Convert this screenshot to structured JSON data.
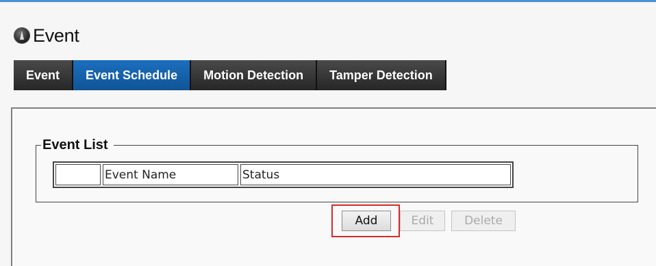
{
  "page": {
    "title": "Event"
  },
  "tabs": [
    {
      "label": "Event",
      "active": false
    },
    {
      "label": "Event Schedule",
      "active": true
    },
    {
      "label": "Motion Detection",
      "active": false
    },
    {
      "label": "Tamper Detection",
      "active": false
    }
  ],
  "event_list": {
    "legend": "Event List",
    "columns": [
      "",
      "Event Name",
      "Status"
    ],
    "rows": []
  },
  "actions": {
    "add_label": "Add",
    "edit_label": "Edit",
    "delete_label": "Delete"
  },
  "colors": {
    "accent": "#1c6fbf",
    "top_bar": "#4a90d9",
    "highlight": "#d42a2a"
  },
  "icons": {
    "title_icon": "camera-logo-icon"
  }
}
